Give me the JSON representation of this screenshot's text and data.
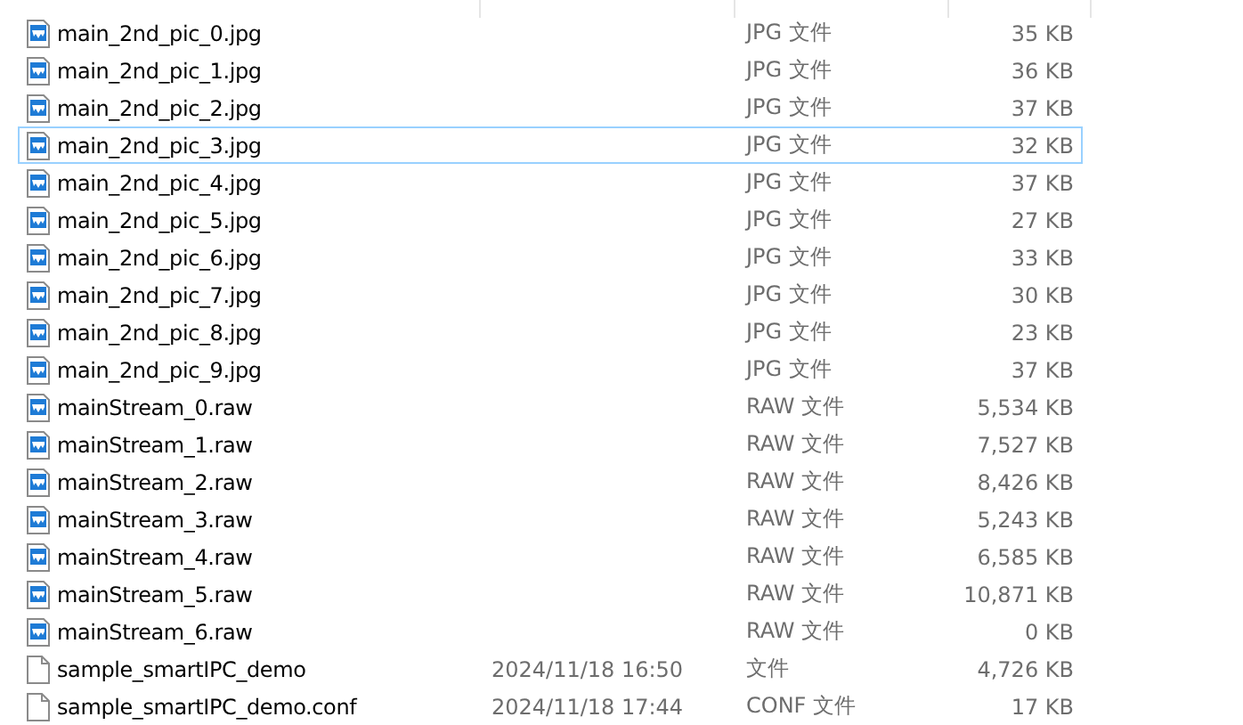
{
  "rows": [
    {
      "kind": "image",
      "name": "main_2nd_pic_0.jpg",
      "type": "JPG 文件",
      "size": "35 KB",
      "focused": false
    },
    {
      "kind": "image",
      "name": "main_2nd_pic_1.jpg",
      "type": "JPG 文件",
      "size": "36 KB",
      "focused": false
    },
    {
      "kind": "image",
      "name": "main_2nd_pic_2.jpg",
      "type": "JPG 文件",
      "size": "37 KB",
      "focused": false
    },
    {
      "kind": "image",
      "name": "main_2nd_pic_3.jpg",
      "type": "JPG 文件",
      "size": "32 KB",
      "focused": true
    },
    {
      "kind": "image",
      "name": "main_2nd_pic_4.jpg",
      "type": "JPG 文件",
      "size": "37 KB",
      "focused": false
    },
    {
      "kind": "image",
      "name": "main_2nd_pic_5.jpg",
      "type": "JPG 文件",
      "size": "27 KB",
      "focused": false
    },
    {
      "kind": "image",
      "name": "main_2nd_pic_6.jpg",
      "type": "JPG 文件",
      "size": "33 KB",
      "focused": false
    },
    {
      "kind": "image",
      "name": "main_2nd_pic_7.jpg",
      "type": "JPG 文件",
      "size": "30 KB",
      "focused": false
    },
    {
      "kind": "image",
      "name": "main_2nd_pic_8.jpg",
      "type": "JPG 文件",
      "size": "23 KB",
      "focused": false
    },
    {
      "kind": "image",
      "name": "main_2nd_pic_9.jpg",
      "type": "JPG 文件",
      "size": "37 KB",
      "focused": false
    },
    {
      "kind": "image",
      "name": "mainStream_0.raw",
      "type": "RAW 文件",
      "size": "5,534 KB",
      "focused": false
    },
    {
      "kind": "image",
      "name": "mainStream_1.raw",
      "type": "RAW 文件",
      "size": "7,527 KB",
      "focused": false
    },
    {
      "kind": "image",
      "name": "mainStream_2.raw",
      "type": "RAW 文件",
      "size": "8,426 KB",
      "focused": false
    },
    {
      "kind": "image",
      "name": "mainStream_3.raw",
      "type": "RAW 文件",
      "size": "5,243 KB",
      "focused": false
    },
    {
      "kind": "image",
      "name": "mainStream_4.raw",
      "type": "RAW 文件",
      "size": "6,585 KB",
      "focused": false
    },
    {
      "kind": "image",
      "name": "mainStream_5.raw",
      "type": "RAW 文件",
      "size": "10,871 KB",
      "focused": false
    },
    {
      "kind": "image",
      "name": "mainStream_6.raw",
      "type": "RAW 文件",
      "size": "0 KB",
      "focused": false
    },
    {
      "kind": "file",
      "name": "sample_smartIPC_demo",
      "date": "2024/11/18 16:50",
      "type": "文件",
      "size": "4,726 KB",
      "focused": false
    },
    {
      "kind": "file",
      "name": "sample_smartIPC_demo.conf",
      "date": "2024/11/18 17:44",
      "type": "CONF 文件",
      "size": "17 KB",
      "focused": false
    }
  ]
}
